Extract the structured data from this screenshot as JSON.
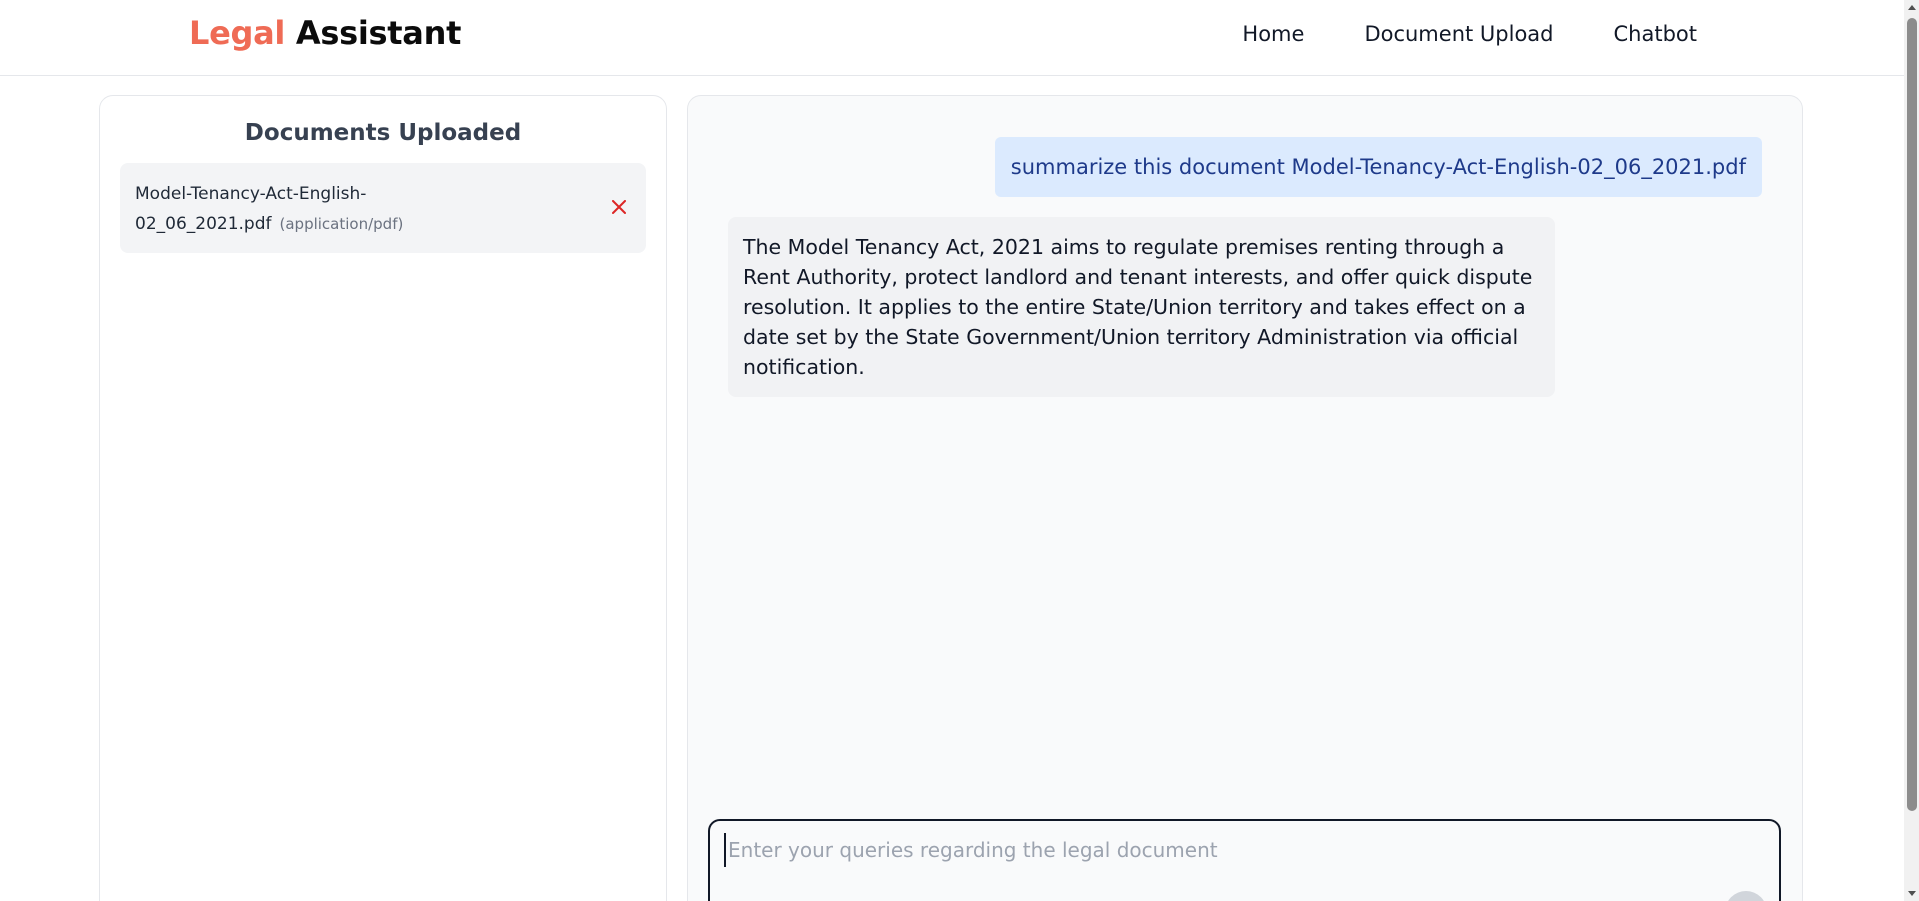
{
  "brand": {
    "accent": "Legal",
    "rest": "Assistant",
    "accent_color": "#ef6b55"
  },
  "nav": {
    "items": [
      {
        "label": "Home"
      },
      {
        "label": "Document Upload"
      },
      {
        "label": "Chatbot"
      }
    ]
  },
  "documents": {
    "title": "Documents Uploaded",
    "items": [
      {
        "name": "Model-Tenancy-Act-English-02_06_2021.pdf",
        "type": "(application/pdf)",
        "remove_icon": "close-icon",
        "remove_color": "#dc2626"
      }
    ]
  },
  "chat": {
    "messages": [
      {
        "role": "user",
        "text": "summarize this document Model-Tenancy-Act-English-02_06_2021.pdf"
      },
      {
        "role": "assistant",
        "text": "The Model Tenancy Act, 2021 aims to regulate premises renting through a Rent Authority, protect landlord and tenant interests, and offer quick dispute resolution. It applies to the entire State/Union territory and takes effect on a date set by the State Government/Union territory Administration via official notification."
      }
    ],
    "input": {
      "placeholder": "Enter your queries regarding the legal document",
      "value": ""
    },
    "send_icon": "send-icon"
  }
}
